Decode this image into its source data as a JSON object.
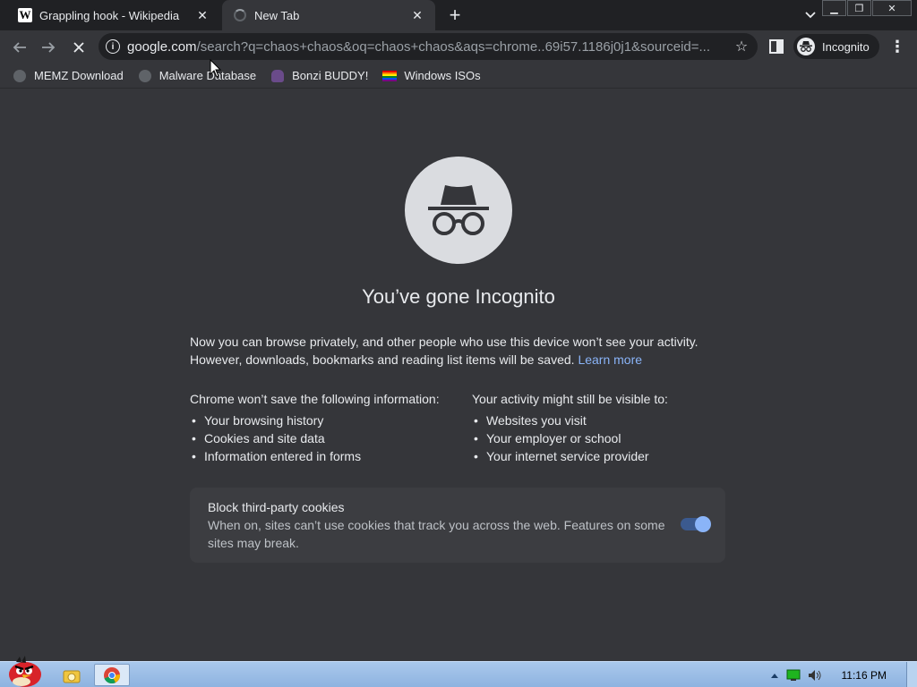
{
  "tabs": [
    {
      "title": "Grappling hook - Wikipedia",
      "favicon": "wikipedia-w-icon",
      "favicon_text": "W"
    },
    {
      "title": "New Tab",
      "favicon": "loading-spinner-icon"
    }
  ],
  "toolbar": {
    "url_host": "google.com",
    "url_path": "/search?q=chaos+chaos&oq=chaos+chaos&aqs=chrome..69i57.1186j0j1&sourceid=...",
    "profile_label": "Incognito"
  },
  "bookmarks": [
    {
      "label": "MEMZ Download",
      "icon": "globe-icon"
    },
    {
      "label": "Malware Database",
      "icon": "globe-icon"
    },
    {
      "label": "Bonzi BUDDY!",
      "icon": "bonzi-icon"
    },
    {
      "label": "Windows ISOs",
      "icon": "rainbow-flag-icon"
    }
  ],
  "incognito": {
    "heading": "You’ve gone Incognito",
    "intro": "Now you can browse privately, and other people who use this device won’t see your activity. However, downloads, bookmarks and reading list items will be saved.",
    "learn_more": "Learn more",
    "wont_save": {
      "heading": "Chrome won’t save the following information:",
      "items": [
        "Your browsing history",
        "Cookies and site data",
        "Information entered in forms"
      ]
    },
    "might_be_visible": {
      "heading": "Your activity might still be visible to:",
      "items": [
        "Websites you visit",
        "Your employer or school",
        "Your internet service provider"
      ]
    },
    "cookies": {
      "title": "Block third-party cookies",
      "description": "When on, sites can’t use cookies that track you across the web. Features on some sites may break.",
      "enabled": true
    }
  },
  "taskbar": {
    "clock": "11:16 PM",
    "apps": [
      "explorer-icon",
      "chrome-icon"
    ]
  },
  "colors": {
    "page_bg": "#35363a",
    "tabstrip_bg": "#202124",
    "link": "#8ab4f8",
    "toggle_on": "#8ab4f8"
  }
}
